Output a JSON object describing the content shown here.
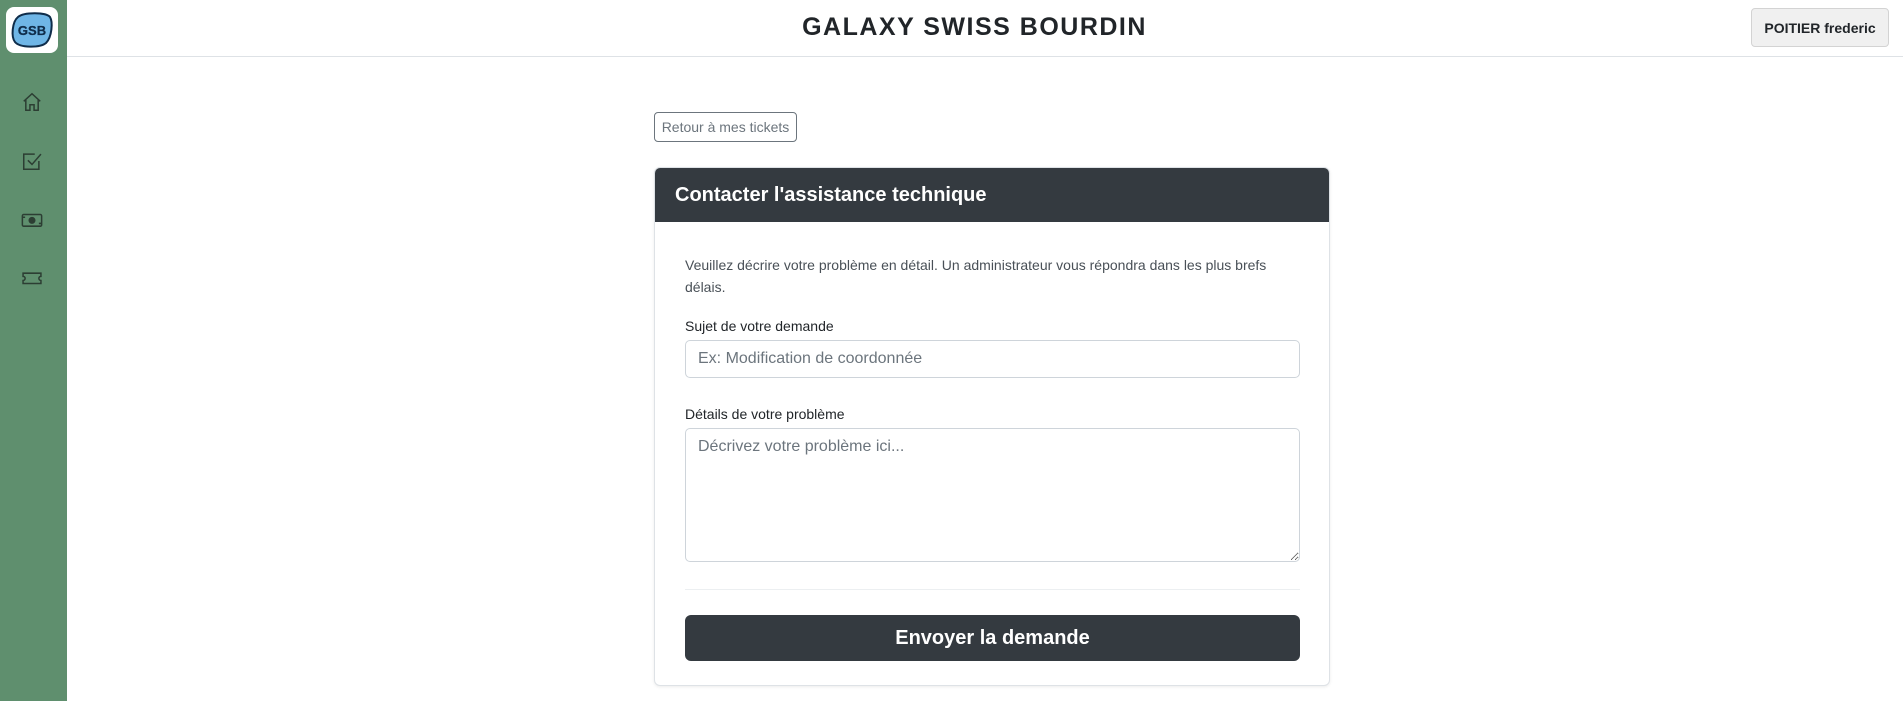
{
  "app": {
    "logo_text": "GSB",
    "brand_title": "GALAXY SWISS BOURDIN"
  },
  "sidebar": {
    "items": [
      {
        "icon": "home-icon"
      },
      {
        "icon": "checkbox-icon"
      },
      {
        "icon": "cash-icon"
      },
      {
        "icon": "ticket-icon"
      }
    ]
  },
  "header": {
    "user_name": "POITIER frederic"
  },
  "nav": {
    "back_label": "Retour à mes tickets"
  },
  "form": {
    "title": "Contacter l'assistance technique",
    "intro": "Veuillez décrire votre problème en détail. Un administrateur vous répondra dans les plus brefs délais.",
    "subject_label": "Sujet de votre demande",
    "subject_placeholder": "Ex: Modification de coordonnée",
    "subject_value": "",
    "details_label": "Détails de votre problème",
    "details_placeholder": "Décrivez votre problème ici...",
    "details_value": "",
    "submit_label": "Envoyer la demande"
  },
  "colors": {
    "sidebar": "#5f8f6e",
    "dark": "#343a40",
    "logo_blue": "#6fb6e6"
  }
}
